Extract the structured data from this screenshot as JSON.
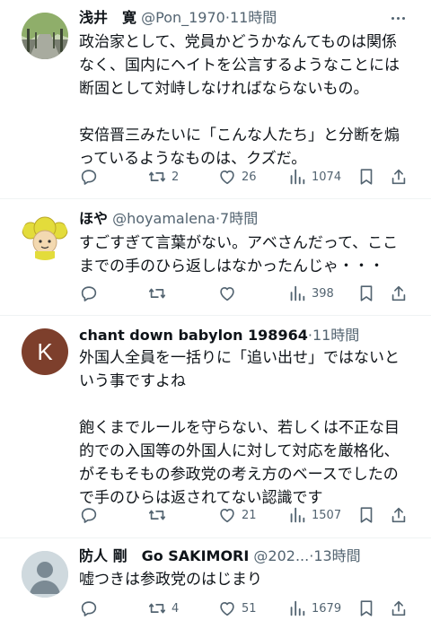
{
  "tweets": [
    {
      "name": "浅井　寛",
      "handle": "@Pon_1970",
      "dot": "·",
      "time": "11時間",
      "text": "政治家として、党員かどうかなんてものは関係\nなく、国内にヘイトを公言するようなことには\n断固として対峙しなければならないもの。\n\n安倍晋三みたいに「こんな人たち」と分断を煽\nっているようなものは、クズだ。",
      "replies": "",
      "retweets": "2",
      "likes": "26",
      "views": "1074"
    },
    {
      "name": "ほや",
      "handle": "@hoyamalena",
      "dot": "·",
      "time": "7時間",
      "text": "すごすぎて言葉がない。アベさんだって、ここ\nまでの手のひら返しはなかったんじゃ・・・",
      "replies": "",
      "retweets": "",
      "likes": "",
      "views": "398"
    },
    {
      "name": "chant down babylon 198964",
      "handle": "",
      "dot": "·",
      "time": "11時間",
      "avatar_letter": "K",
      "text": "外国人全員を一括りに「追い出せ」ではないと\nいう事ですよね\n\n飽くまでルールを守らない、若しくは不正な目\n的での入国等の外国人に対して対応を厳格化、\nがそもそもの参政党の考え方のベースでしたの\nで手のひらは返されてない認識です",
      "replies": "",
      "retweets": "",
      "likes": "21",
      "views": "1507"
    },
    {
      "name": "防人 剛　Go SAKIMORI",
      "handle": "@202...",
      "dot": "·",
      "time": "13時間",
      "text": "嘘つきは参政党のはじまり",
      "replies": "",
      "retweets": "4",
      "likes": "51",
      "views": "1679"
    }
  ],
  "colors": {
    "text": "#0f1419",
    "secondary": "#536471",
    "divider": "#eff3f4",
    "avatar_k": "#7d3f2c"
  },
  "icons": [
    "reply-icon",
    "retweet-icon",
    "like-icon",
    "views-icon",
    "bookmark-icon",
    "share-icon",
    "more-icon"
  ]
}
